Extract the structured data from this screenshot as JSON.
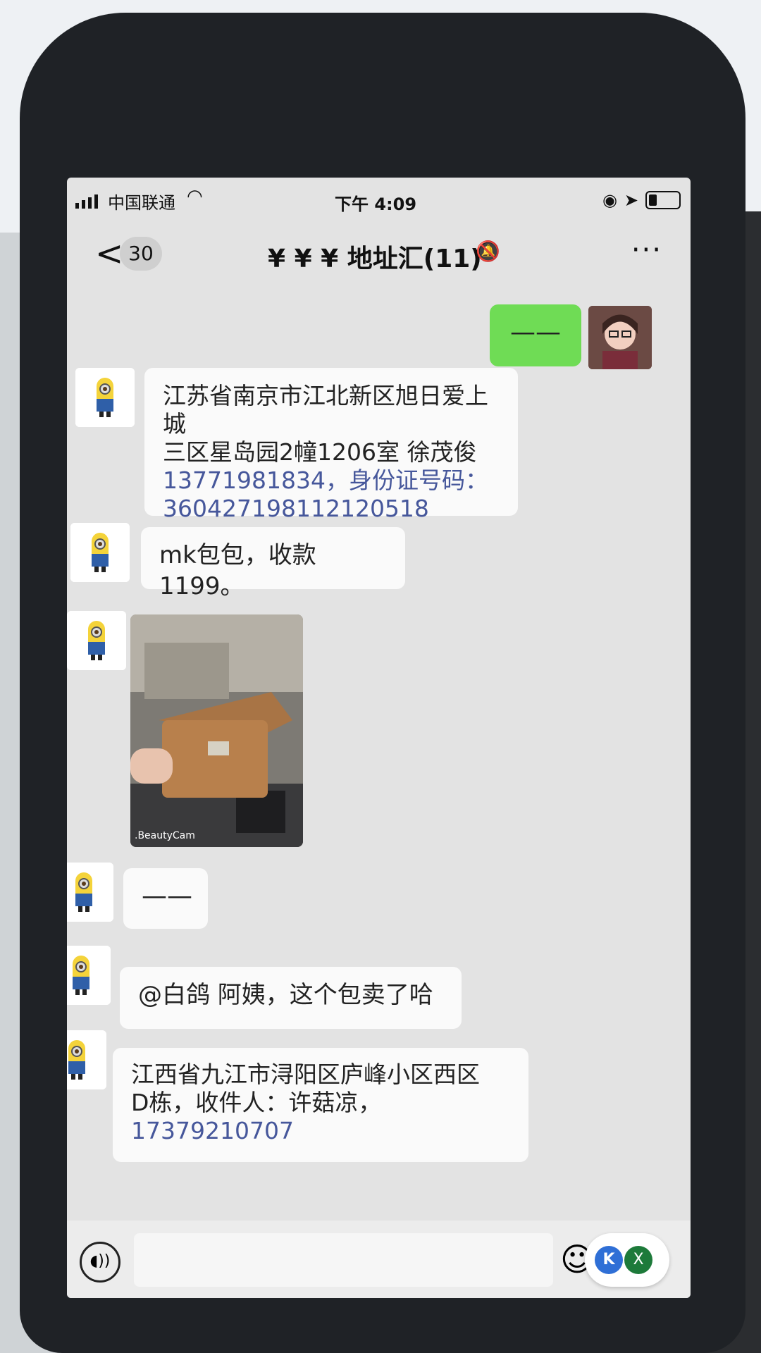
{
  "status_bar": {
    "carrier": "中国联通",
    "time": "下午 4:09",
    "battery_level": 0.3
  },
  "nav": {
    "back_label": "<",
    "unread_count": "30",
    "chat_title": "¥ ¥ ¥ 地址汇(11)",
    "more_label": "···"
  },
  "messages": [
    {
      "sender": "self",
      "type": "text",
      "text": "——"
    },
    {
      "sender": "minion",
      "type": "text",
      "lines": [
        "江苏省南京市江北新区旭日爱上城",
        "三区星岛园2幢1206室 徐茂俊",
        "13771981834，身份证号码：",
        "360427198112120518"
      ]
    },
    {
      "sender": "minion",
      "type": "text",
      "text": "mk包包，收款1199。"
    },
    {
      "sender": "minion",
      "type": "image",
      "watermark": ".BeautyCam"
    },
    {
      "sender": "minion",
      "type": "text",
      "text": "——"
    },
    {
      "sender": "minion",
      "type": "text",
      "text": "@白鸽 阿姨，这个包卖了哈"
    },
    {
      "sender": "minion",
      "type": "text",
      "lines": [
        "江西省九江市浔阳区庐峰小区西区",
        "D栋，收件人：许菇凉，",
        "17379210707"
      ]
    }
  ],
  "input_bar": {
    "voice_icon": "voice-icon",
    "emoji_icon": "emoji-icon",
    "overlay_left": "K",
    "overlay_right": "X"
  },
  "colors": {
    "self_bubble": "#6fdc55",
    "link_blue": "#46579b"
  }
}
